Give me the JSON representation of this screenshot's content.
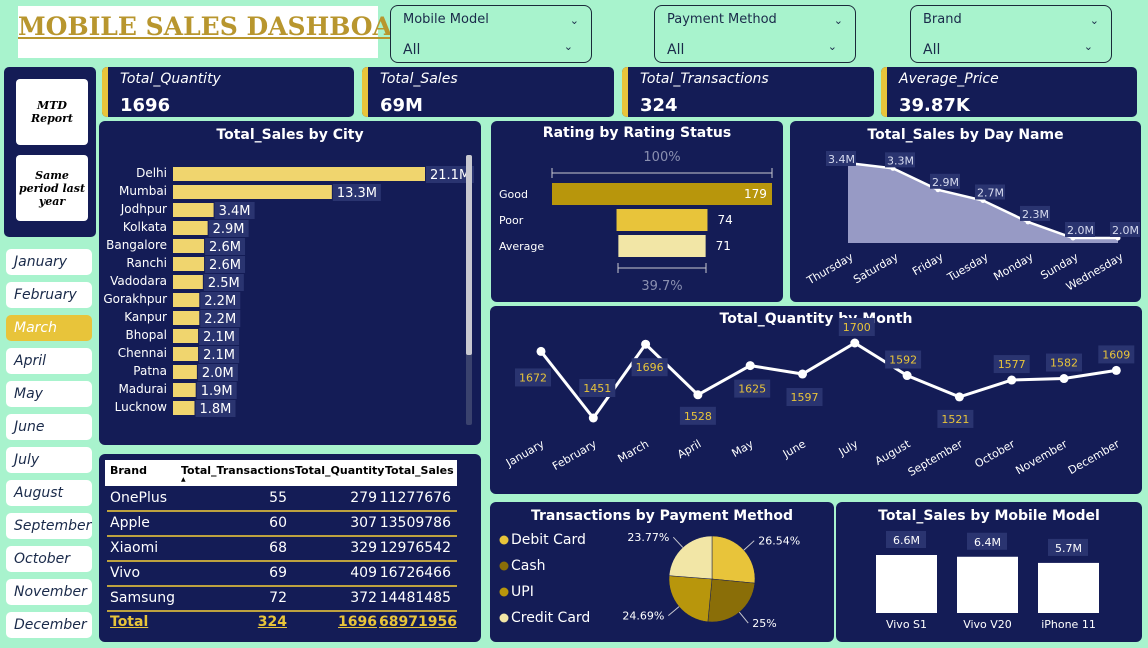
{
  "title": "MOBILE SALES DASHBOARD",
  "filters": [
    {
      "label": "Mobile Model",
      "value": "All"
    },
    {
      "label": "Payment Method",
      "value": "All"
    },
    {
      "label": "Brand",
      "value": "All"
    }
  ],
  "kpis": [
    {
      "label": "Total_Quantity",
      "value": "1696"
    },
    {
      "label": "Total_Sales",
      "value": "69M"
    },
    {
      "label": "Total_Transactions",
      "value": "324"
    },
    {
      "label": "Average_Price",
      "value": "39.87K"
    }
  ],
  "nav_buttons": {
    "mtd": "MTD Report",
    "same_period": "Same period last year"
  },
  "months": [
    "January",
    "February",
    "March",
    "April",
    "May",
    "June",
    "July",
    "August",
    "September",
    "October",
    "November",
    "December"
  ],
  "selected_month": "March",
  "colors": {
    "panel": "#141c56",
    "accent": "#e8c43a",
    "background": "#a8f3cd",
    "gold_dark": "#b8960c",
    "gold_light": "#f2e6a6"
  },
  "charts": {
    "city": {
      "title": "Total_Sales by City",
      "type": "bar",
      "categories": [
        "Delhi",
        "Mumbai",
        "Jodhpur",
        "Kolkata",
        "Bangalore",
        "Ranchi",
        "Vadodara",
        "Gorakhpur",
        "Kanpur",
        "Bhopal",
        "Chennai",
        "Patna",
        "Madurai",
        "Lucknow"
      ],
      "values": [
        21.1,
        13.3,
        3.4,
        2.9,
        2.6,
        2.6,
        2.5,
        2.2,
        2.2,
        2.1,
        2.1,
        2.0,
        1.9,
        1.8
      ],
      "labels": [
        "21.1M",
        "13.3M",
        "3.4M",
        "2.9M",
        "2.6M",
        "2.6M",
        "2.5M",
        "2.2M",
        "2.2M",
        "2.1M",
        "2.1M",
        "2.0M",
        "1.9M",
        "1.8M"
      ]
    },
    "rating": {
      "title": "Rating by Rating Status",
      "type": "bar",
      "categories": [
        "Good",
        "Poor",
        "Average"
      ],
      "values": [
        179,
        74,
        71
      ],
      "top_label": "100%",
      "bottom_label": "39.7%"
    },
    "day": {
      "title": "Total_Sales by Day Name",
      "type": "area",
      "categories": [
        "Thursday",
        "Saturday",
        "Friday",
        "Tuesday",
        "Monday",
        "Sunday",
        "Wednesday"
      ],
      "values": [
        3.4,
        3.3,
        2.9,
        2.7,
        2.3,
        2.0,
        2.0
      ],
      "labels": [
        "3.4M",
        "3.3M",
        "2.9M",
        "2.7M",
        "2.3M",
        "2.0M",
        "2.0M"
      ]
    },
    "month": {
      "title": "Total_Quantity by Month",
      "type": "line",
      "categories": [
        "January",
        "February",
        "March",
        "April",
        "May",
        "June",
        "July",
        "August",
        "September",
        "October",
        "November",
        "December"
      ],
      "values": [
        1672,
        1451,
        1696,
        1528,
        1625,
        1597,
        1700,
        1592,
        1521,
        1577,
        1582,
        1609
      ]
    },
    "payment": {
      "title": "Transactions by Payment Method",
      "type": "pie",
      "categories": [
        "Debit Card",
        "Cash",
        "UPI",
        "Credit Card"
      ],
      "values": [
        26.54,
        25,
        24.69,
        23.77
      ],
      "labels": [
        "26.54%",
        "25%",
        "24.69%",
        "23.77%"
      ]
    },
    "model": {
      "title": "Total_Sales by Mobile Model",
      "type": "bar",
      "categories": [
        "Vivo S1",
        "Vivo V20",
        "iPhone 11"
      ],
      "values": [
        6.6,
        6.4,
        5.7
      ],
      "labels": [
        "6.6M",
        "6.4M",
        "5.7M"
      ]
    }
  },
  "brand_table": {
    "headers": [
      "Brand",
      "Total_Transactions",
      "Total_Quantity",
      "Total_Sales"
    ],
    "rows": [
      [
        "OnePlus",
        "55",
        "279",
        "11277676"
      ],
      [
        "Apple",
        "60",
        "307",
        "13509786"
      ],
      [
        "Xiaomi",
        "68",
        "329",
        "12976542"
      ],
      [
        "Vivo",
        "69",
        "409",
        "16726466"
      ],
      [
        "Samsung",
        "72",
        "372",
        "14481485"
      ]
    ],
    "total": [
      "Total",
      "324",
      "1696",
      "68971956"
    ]
  }
}
